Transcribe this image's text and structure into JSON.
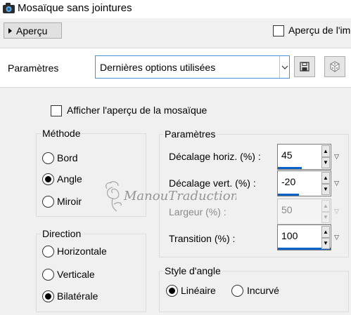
{
  "window": {
    "title": "Mosaïque sans jointures"
  },
  "preview": {
    "toggle_label": "Aperçu",
    "live_preview_label": "Aperçu de l'im"
  },
  "presets": {
    "label": "Paramètres",
    "selected": "Dernières options utilisées"
  },
  "tile_preview": {
    "label": "Afficher l'aperçu de la mosaïque",
    "checked": false
  },
  "methode": {
    "title": "Méthode",
    "options": [
      {
        "label": "Bord",
        "selected": false
      },
      {
        "label": "Angle",
        "selected": true
      },
      {
        "label": "Miroir",
        "selected": false
      }
    ]
  },
  "direction": {
    "title": "Direction",
    "options": [
      {
        "label": "Horizontale",
        "selected": false
      },
      {
        "label": "Verticale",
        "selected": false
      },
      {
        "label": "Bilatérale",
        "selected": true
      }
    ]
  },
  "parametres": {
    "title": "Paramètres",
    "fields": [
      {
        "label": "Décalage horiz. (%) :",
        "value": "45",
        "fill": 0.45,
        "enabled": true
      },
      {
        "label": "Décalage vert. (%) :",
        "value": "-20",
        "fill": 0.4,
        "enabled": true
      },
      {
        "label": "Largeur (%) :",
        "value": "50",
        "fill": 0.0,
        "enabled": false
      },
      {
        "label": "Transition (%) :",
        "value": "100",
        "fill": 1.0,
        "enabled": true
      }
    ]
  },
  "style_angle": {
    "title": "Style d'angle",
    "options": [
      {
        "label": "Linéaire",
        "selected": true
      },
      {
        "label": "Incurvé",
        "selected": false
      }
    ]
  },
  "watermark": {
    "text": "ManouTraductions"
  }
}
